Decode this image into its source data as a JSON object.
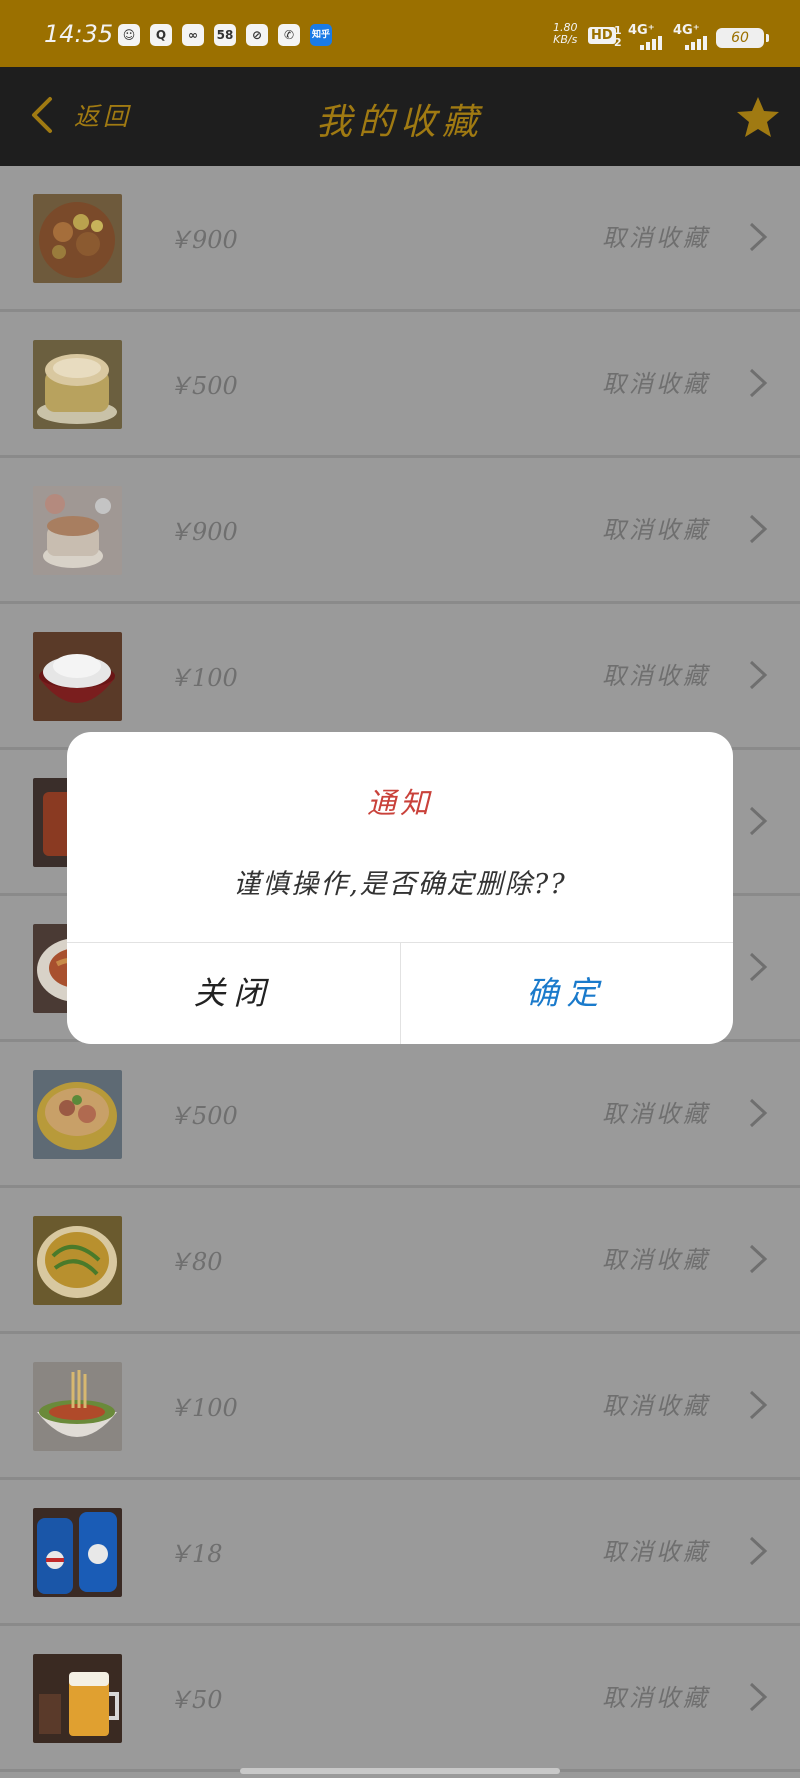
{
  "status_bar": {
    "time": "14:35",
    "apps": [
      {
        "icon": "avatar-app-icon",
        "text": "☺"
      },
      {
        "icon": "search-app-icon",
        "text": "Q"
      },
      {
        "icon": "cloud-app-icon",
        "text": "∞"
      },
      {
        "icon": "58-app-icon",
        "text": "58"
      },
      {
        "icon": "link-app-icon",
        "text": "⊘"
      },
      {
        "icon": "phone-app-icon",
        "text": "✆"
      },
      {
        "icon": "zhihu-app-icon",
        "text": "知乎"
      }
    ],
    "speed_value": "1.80",
    "speed_unit": "KB/s",
    "hd_label": "HD",
    "hd_sub": "1\n2",
    "network_1": "4G⁺",
    "network_2": "4G⁺",
    "battery": "60"
  },
  "header": {
    "back_label": "返回",
    "title": "我的收藏",
    "accent_color": "#a07a12"
  },
  "items": [
    {
      "price": "￥900",
      "cancel_label": "取消收藏",
      "image": "braised-meat-dish"
    },
    {
      "price": "￥500",
      "cancel_label": "取消收藏",
      "image": "cake"
    },
    {
      "price": "￥900",
      "cancel_label": "取消收藏",
      "image": "soup-bowl"
    },
    {
      "price": "￥100",
      "cancel_label": "取消收藏",
      "image": "rice-bowl"
    },
    {
      "price": "",
      "cancel_label": "",
      "image": "grilled-dish"
    },
    {
      "price": "",
      "cancel_label": "",
      "image": "noodle-plate"
    },
    {
      "price": "￥500",
      "cancel_label": "取消收藏",
      "image": "noodle-soup"
    },
    {
      "price": "￥80",
      "cancel_label": "取消收藏",
      "image": "fried-noodles"
    },
    {
      "price": "￥100",
      "cancel_label": "取消收藏",
      "image": "ramen-bowl"
    },
    {
      "price": "￥18",
      "cancel_label": "取消收藏",
      "image": "pepsi-cans"
    },
    {
      "price": "￥50",
      "cancel_label": "取消收藏",
      "image": "beer-glass"
    }
  ],
  "dialog": {
    "title": "通知",
    "message": "谨慎操作,是否确定删除??",
    "close_label": "关闭",
    "confirm_label": "确定",
    "title_color": "#c9413a",
    "confirm_color": "#1a7acb"
  }
}
